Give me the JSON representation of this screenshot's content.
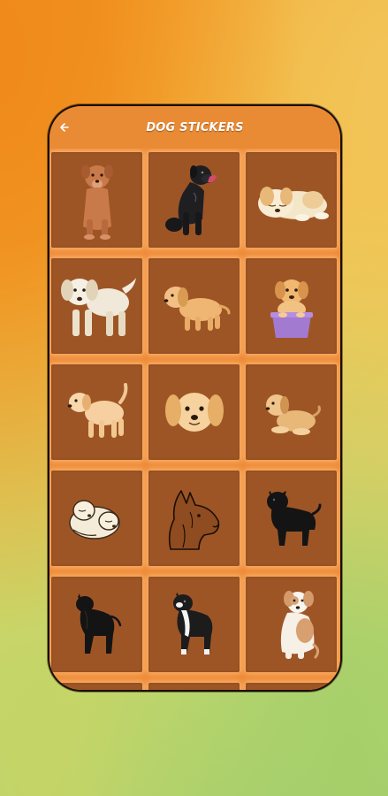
{
  "appbar": {
    "title": "DOG STICKERS",
    "back_icon": "back-arrow-icon"
  },
  "colors": {
    "appbar": "#e98a34",
    "tile": "#9e5526",
    "tile_glow": "#ffbe78"
  },
  "stickers": [
    {
      "name": "standing-brown-pup",
      "icon": "dog-sticker-icon"
    },
    {
      "name": "black-labrador-sitting",
      "icon": "dog-sticker-icon"
    },
    {
      "name": "sleeping-golden-puppy",
      "icon": "dog-sticker-icon"
    },
    {
      "name": "white-labrador-puppy",
      "icon": "dog-sticker-icon"
    },
    {
      "name": "golden-puppy-walking",
      "icon": "dog-sticker-icon"
    },
    {
      "name": "puppy-in-purple-basket",
      "icon": "dog-sticker-icon"
    },
    {
      "name": "cream-puppy-standing",
      "icon": "dog-sticker-icon"
    },
    {
      "name": "puppy-face",
      "icon": "dog-sticker-icon"
    },
    {
      "name": "puppy-lying-down",
      "icon": "dog-sticker-icon"
    },
    {
      "name": "two-puppies-sketch",
      "icon": "dog-sticker-icon"
    },
    {
      "name": "pitbull-head-line-art",
      "icon": "dog-sticker-icon"
    },
    {
      "name": "black-staffy-silhouette",
      "icon": "dog-sticker-icon"
    },
    {
      "name": "black-pitbull-silhouette",
      "icon": "dog-sticker-icon"
    },
    {
      "name": "black-white-pitbull",
      "icon": "dog-sticker-icon"
    },
    {
      "name": "jack-russell-sitting",
      "icon": "dog-sticker-icon"
    }
  ]
}
